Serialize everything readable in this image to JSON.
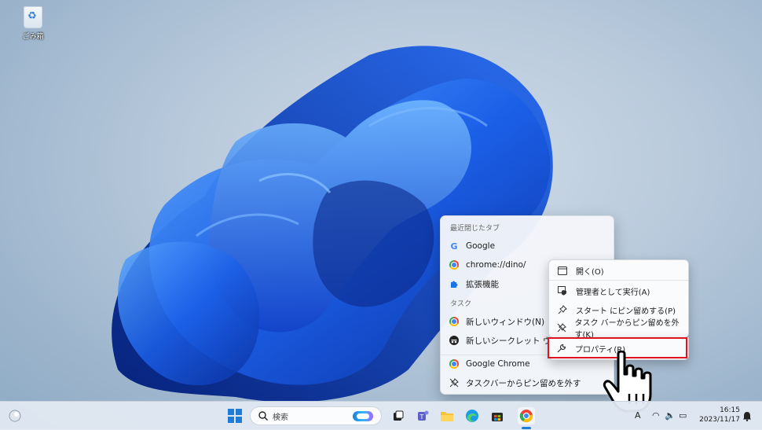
{
  "desktop": {
    "recycle_bin_label": "ごみ箱"
  },
  "jump_list": {
    "recent_header": "最近閉じたタブ",
    "recent_items": [
      "Google",
      "chrome://dino/",
      "拡張機能"
    ],
    "tasks_header": "タスク",
    "task_items": [
      "新しいウィンドウ(N)",
      "新しいシークレット ウィンドウ"
    ],
    "app_name": "Google Chrome",
    "unpin_label": "タスクバーからピン留めを外す"
  },
  "context_menu": {
    "items": [
      "開く(O)",
      "管理者として実行(A)",
      "スタート にピン留めする(P)",
      "タスク バーからピン留めを外す(K)"
    ],
    "properties": "プロパティ(R)"
  },
  "taskbar": {
    "search_label": "検索",
    "time": "16:15",
    "date": "2023/11/17"
  },
  "colors": {
    "highlight": "#e0141e",
    "accent": "#1e7cd6"
  }
}
